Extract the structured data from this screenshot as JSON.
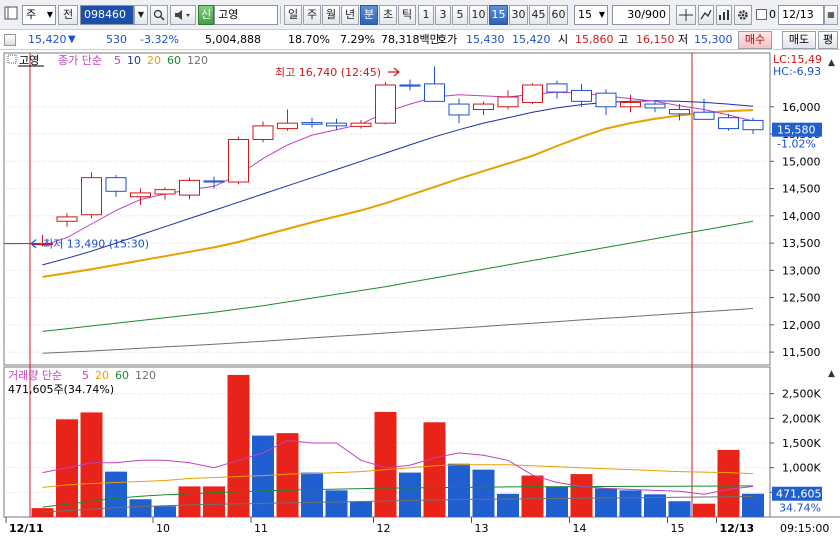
{
  "toolbar": {
    "market_select": "주",
    "prev_label": "전",
    "stock_code": "098460",
    "badge_sin": "신",
    "stock_name": "고영",
    "periods": [
      "일",
      "주",
      "월",
      "년",
      "분",
      "초",
      "틱"
    ],
    "active_period": "분",
    "intervals": [
      "1",
      "3",
      "5",
      "10",
      "15",
      "30",
      "45",
      "60"
    ],
    "active_interval": "15",
    "interval_value": "15",
    "count_value": "30/900",
    "date_value": "12/13",
    "date_checkbox_label": "0"
  },
  "quote": {
    "price": "15,420",
    "change": "530",
    "change_pct": "-3.32%",
    "volume": "5,004,888",
    "turnover_pct": "18.70%",
    "ratio_pct": "7.29%",
    "amount": "78,318백만",
    "bid_label": "호가",
    "ask_price": "15,430",
    "bid_price": "15,420",
    "open_label": "시",
    "open": "15,860",
    "high_label": "고",
    "high": "16,150",
    "low_label": "저",
    "low": "15,300",
    "buy_button": "매수",
    "sell_button": "매도",
    "eval_button": "평"
  },
  "price_panel": {
    "title": "고영",
    "legend_label": "종가 단순",
    "ma_periods": [
      "5",
      "10",
      "20",
      "60",
      "120"
    ],
    "ma_colors": [
      "#c040c0",
      "#1e2ea8",
      "#e8a000",
      "#1a8a30",
      "#707070"
    ],
    "y_ticks": [
      "16,000",
      "15,500",
      "15,000",
      "14,500",
      "14,000",
      "13,500",
      "13,000",
      "12,500",
      "12,000",
      "11,500"
    ],
    "lc_label": "LC:15,49",
    "hc_label": "HC:-6,93",
    "current_price_label": "15,580",
    "current_pct_label": "-1.02%",
    "high_annotation": "최고 16,740 (12:45)",
    "low_annotation": "최저 13,490 (15:30)"
  },
  "volume_panel": {
    "legend_label": "거래량 단순",
    "ma_periods": [
      "5",
      "20",
      "60",
      "120"
    ],
    "ma_colors": [
      "#c040c0",
      "#e8a000",
      "#1a8a30",
      "#707070"
    ],
    "sub_label": "471,605주(34.74%)",
    "y_ticks": [
      "2,500K",
      "2,000K",
      "1,500K",
      "1,000K",
      "500K"
    ],
    "current_vol_label": "471,605",
    "current_vol_pct": "34.74%"
  },
  "x_axis": {
    "labels": [
      "12/11",
      "10",
      "11",
      "12",
      "13",
      "14",
      "15",
      "12/13"
    ],
    "time_label": "09:15:00"
  },
  "chart_data": {
    "type": "candlestick",
    "up_color": "#d01818",
    "down_color": "#1c4fd0",
    "price_ylim": [
      11300,
      16950
    ],
    "volume_ylim": [
      0,
      3000000
    ],
    "candles": [
      {
        "o": 13480,
        "h": 13650,
        "l": 13440,
        "c": 13490
      },
      {
        "o": 13900,
        "h": 14050,
        "l": 13800,
        "c": 13980
      },
      {
        "o": 14020,
        "h": 14800,
        "l": 13950,
        "c": 14700
      },
      {
        "o": 14700,
        "h": 14750,
        "l": 14350,
        "c": 14450
      },
      {
        "o": 14350,
        "h": 14500,
        "l": 14200,
        "c": 14420
      },
      {
        "o": 14400,
        "h": 14520,
        "l": 14300,
        "c": 14480
      },
      {
        "o": 14380,
        "h": 14700,
        "l": 14300,
        "c": 14650
      },
      {
        "o": 14640,
        "h": 14720,
        "l": 14500,
        "c": 14620
      },
      {
        "o": 14620,
        "h": 15450,
        "l": 14580,
        "c": 15400
      },
      {
        "o": 15400,
        "h": 15730,
        "l": 15350,
        "c": 15650
      },
      {
        "o": 15600,
        "h": 15950,
        "l": 15560,
        "c": 15700
      },
      {
        "o": 15710,
        "h": 15800,
        "l": 15620,
        "c": 15680
      },
      {
        "o": 15700,
        "h": 15780,
        "l": 15580,
        "c": 15650
      },
      {
        "o": 15640,
        "h": 15760,
        "l": 15600,
        "c": 15700
      },
      {
        "o": 15700,
        "h": 16450,
        "l": 15680,
        "c": 16400
      },
      {
        "o": 16400,
        "h": 16500,
        "l": 16300,
        "c": 16380
      },
      {
        "o": 16420,
        "h": 16740,
        "l": 16100,
        "c": 16100
      },
      {
        "o": 16050,
        "h": 16150,
        "l": 15700,
        "c": 15850
      },
      {
        "o": 15950,
        "h": 16100,
        "l": 15850,
        "c": 16050
      },
      {
        "o": 16000,
        "h": 16300,
        "l": 15950,
        "c": 16180
      },
      {
        "o": 16080,
        "h": 16430,
        "l": 16050,
        "c": 16400
      },
      {
        "o": 16420,
        "h": 16480,
        "l": 16150,
        "c": 16270
      },
      {
        "o": 16300,
        "h": 16420,
        "l": 16000,
        "c": 16100
      },
      {
        "o": 16250,
        "h": 16320,
        "l": 15850,
        "c": 16000
      },
      {
        "o": 16000,
        "h": 16220,
        "l": 15900,
        "c": 16080
      },
      {
        "o": 16050,
        "h": 16120,
        "l": 15900,
        "c": 15980
      },
      {
        "o": 15950,
        "h": 16050,
        "l": 15750,
        "c": 15870
      },
      {
        "o": 15900,
        "h": 16150,
        "l": 15800,
        "c": 15770
      },
      {
        "o": 15800,
        "h": 15870,
        "l": 15560,
        "c": 15600
      },
      {
        "o": 15750,
        "h": 15800,
        "l": 15500,
        "c": 15580
      }
    ],
    "volumes": [
      {
        "v": 180000,
        "up": true
      },
      {
        "v": 1980000,
        "up": true
      },
      {
        "v": 2120000,
        "up": true
      },
      {
        "v": 920000,
        "up": false
      },
      {
        "v": 360000,
        "up": false
      },
      {
        "v": 220000,
        "up": false
      },
      {
        "v": 620000,
        "up": true
      },
      {
        "v": 620000,
        "up": true
      },
      {
        "v": 2880000,
        "up": true
      },
      {
        "v": 1650000,
        "up": false
      },
      {
        "v": 1700000,
        "up": true
      },
      {
        "v": 900000,
        "up": false
      },
      {
        "v": 540000,
        "up": false
      },
      {
        "v": 310000,
        "up": false
      },
      {
        "v": 2130000,
        "up": true
      },
      {
        "v": 900000,
        "up": false
      },
      {
        "v": 1920000,
        "up": true
      },
      {
        "v": 1080000,
        "up": false
      },
      {
        "v": 960000,
        "up": false
      },
      {
        "v": 470000,
        "up": false
      },
      {
        "v": 840000,
        "up": true
      },
      {
        "v": 620000,
        "up": false
      },
      {
        "v": 870000,
        "up": true
      },
      {
        "v": 580000,
        "up": false
      },
      {
        "v": 540000,
        "up": false
      },
      {
        "v": 460000,
        "up": false
      },
      {
        "v": 320000,
        "up": false
      },
      {
        "v": 270000,
        "up": true
      },
      {
        "v": 1360000,
        "up": true
      },
      {
        "v": 471605,
        "up": false
      }
    ],
    "price_ma": {
      "ma5": [
        13450,
        13600,
        13850,
        14100,
        14300,
        14400,
        14480,
        14540,
        14750,
        15050,
        15300,
        15480,
        15580,
        15680,
        15900,
        16050,
        16180,
        16220,
        16200,
        16180,
        16230,
        16270,
        16250,
        16200,
        16150,
        16100,
        16020,
        15950,
        15850,
        15740
      ],
      "ma10": [
        13100,
        13220,
        13350,
        13500,
        13650,
        13800,
        13950,
        14100,
        14250,
        14400,
        14550,
        14700,
        14850,
        15000,
        15150,
        15300,
        15450,
        15580,
        15700,
        15800,
        15900,
        15980,
        16040,
        16080,
        16100,
        16110,
        16100,
        16080,
        16050,
        16010
      ],
      "ma20": [
        12880,
        12950,
        13020,
        13100,
        13180,
        13260,
        13340,
        13420,
        13520,
        13640,
        13760,
        13880,
        13990,
        14100,
        14230,
        14380,
        14530,
        14680,
        14820,
        14960,
        15100,
        15280,
        15450,
        15600,
        15700,
        15780,
        15840,
        15890,
        15920,
        15940
      ],
      "ma60": [
        11880,
        11930,
        11980,
        12030,
        12080,
        12130,
        12180,
        12230,
        12290,
        12350,
        12420,
        12490,
        12560,
        12630,
        12700,
        12780,
        12860,
        12940,
        13020,
        13100,
        13180,
        13260,
        13340,
        13420,
        13500,
        13580,
        13660,
        13740,
        13820,
        13900
      ],
      "ma120": [
        11480,
        11500,
        11520,
        11545,
        11570,
        11595,
        11620,
        11645,
        11670,
        11700,
        11730,
        11760,
        11790,
        11820,
        11850,
        11880,
        11910,
        11940,
        11970,
        12000,
        12030,
        12060,
        12090,
        12120,
        12150,
        12180,
        12210,
        12240,
        12270,
        12300
      ]
    },
    "volume_ma": {
      "ma5": [
        900000,
        1000000,
        1100000,
        1100000,
        1150000,
        1150000,
        1100000,
        1000000,
        1150000,
        1300000,
        1550000,
        1500000,
        1500000,
        1150000,
        1000000,
        1050000,
        1200000,
        1300000,
        1250000,
        1150000,
        850000,
        700000,
        620000,
        580000,
        560000,
        540000,
        520000,
        460000,
        560000,
        620000
      ],
      "ma20": [
        600000,
        650000,
        680000,
        700000,
        720000,
        740000,
        780000,
        800000,
        820000,
        840000,
        870000,
        880000,
        900000,
        920000,
        960000,
        1000000,
        1040000,
        1060000,
        1060000,
        1060000,
        1040000,
        1020000,
        1000000,
        980000,
        960000,
        940000,
        920000,
        910000,
        900000,
        880000
      ],
      "ma60": [
        200000,
        260000,
        320000,
        380000,
        420000,
        450000,
        470000,
        490000,
        510000,
        530000,
        545000,
        555000,
        565000,
        575000,
        585000,
        590000,
        595000,
        600000,
        605000,
        610000,
        612000,
        614000,
        616000,
        618000,
        620000,
        622000,
        624000,
        626000,
        628000,
        630000
      ],
      "ma120": [
        100000,
        130000,
        160000,
        190000,
        210000,
        230000,
        245000,
        255000,
        265000,
        275000,
        285000,
        295000,
        305000,
        315000,
        325000,
        335000,
        345000,
        355000,
        360000,
        365000,
        370000,
        375000,
        380000,
        385000,
        390000,
        395000,
        400000,
        405000,
        410000,
        415000
      ]
    }
  }
}
